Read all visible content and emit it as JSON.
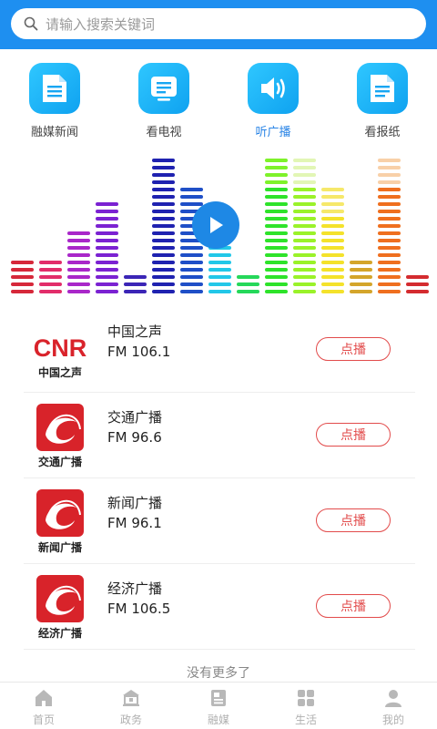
{
  "search": {
    "placeholder": "请输入搜索关键词"
  },
  "categories": [
    {
      "label": "融媒新闻",
      "icon": "news-doc-icon",
      "active": false
    },
    {
      "label": "看电视",
      "icon": "tv-icon",
      "active": false
    },
    {
      "label": "听广播",
      "icon": "speaker-icon",
      "active": true
    },
    {
      "label": "看报纸",
      "icon": "newspaper-icon",
      "active": false
    }
  ],
  "visualizer": {
    "icon": "play-icon",
    "levels": [
      5,
      5,
      9,
      13,
      3,
      19,
      15,
      12,
      3,
      19,
      19,
      15,
      5,
      19,
      3
    ],
    "max_level": 19,
    "colors": [
      [
        "#d6283a"
      ],
      [
        "#e22d6a"
      ],
      [
        "#a927c9"
      ],
      [
        "#7b22d2"
      ],
      [
        "#3b25b6"
      ],
      [
        "#1f22b0"
      ],
      [
        "#1f4fc7"
      ],
      [
        "#22c7e8"
      ],
      [
        "#25d85a"
      ],
      [
        "#2ee32a",
        "#7ef22a"
      ],
      [
        "#9af229",
        "#e2f6b5"
      ],
      [
        "#f4e22b",
        "#f6e86a"
      ],
      [
        "#d4a52b"
      ],
      [
        "#ef6f1f",
        "#f8d0a8"
      ],
      [
        "#d42b2f"
      ]
    ]
  },
  "stations": [
    {
      "name": "中国之声",
      "freq": "FM 106.1",
      "button": "点播",
      "logo_type": "cnr",
      "logo_main": "CNR",
      "logo_sub": "中国之声"
    },
    {
      "name": "交通广播",
      "freq": "FM 96.6",
      "button": "点播",
      "logo_type": "red",
      "logo_sub": "交通广播"
    },
    {
      "name": "新闻广播",
      "freq": "FM 96.1",
      "button": "点播",
      "logo_type": "red",
      "logo_sub": "新闻广播"
    },
    {
      "name": "经济广播",
      "freq": "FM 106.5",
      "button": "点播",
      "logo_type": "red",
      "logo_sub": "经济广播"
    }
  ],
  "footer_text": "没有更多了",
  "tabs": [
    {
      "label": "首页",
      "icon": "home-icon"
    },
    {
      "label": "政务",
      "icon": "government-icon"
    },
    {
      "label": "融媒",
      "icon": "media-icon"
    },
    {
      "label": "生活",
      "icon": "grid-icon"
    },
    {
      "label": "我的",
      "icon": "user-icon"
    }
  ],
  "colors": {
    "brand": "#1E8FF0",
    "button_red": "#e24b4b",
    "active_tab_text": "#2b85e6"
  }
}
